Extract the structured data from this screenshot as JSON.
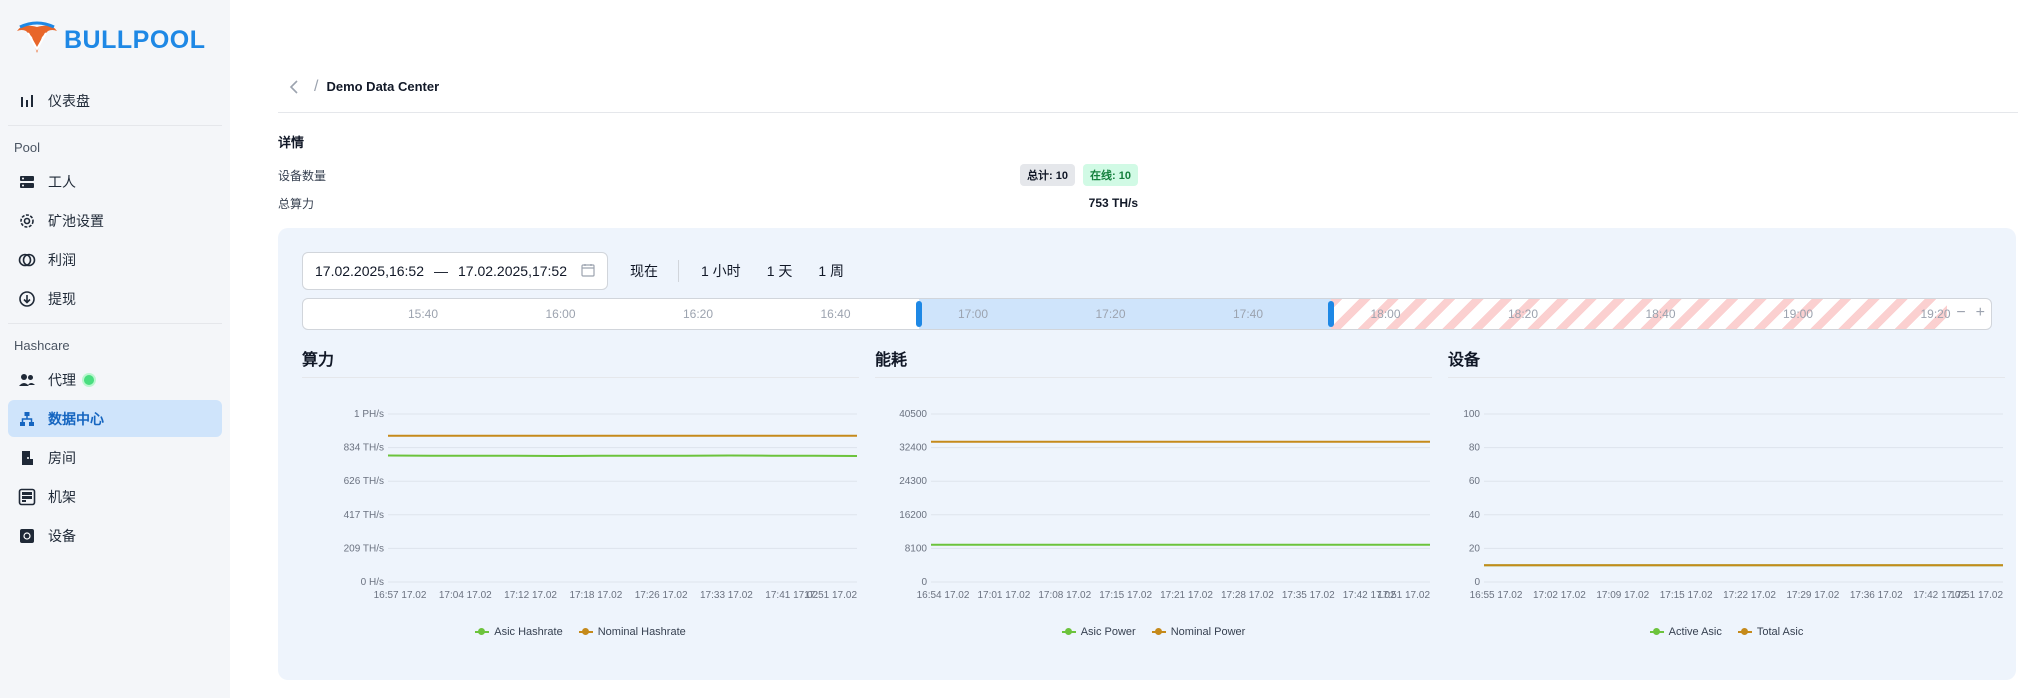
{
  "app": {
    "brand": "BULLPOOL"
  },
  "sidebar": {
    "dashboard": "仪表盘",
    "section_pool": "Pool",
    "pool_items": [
      {
        "label": "工人",
        "icon": "server-icon"
      },
      {
        "label": "矿池设置",
        "icon": "gear-icon"
      },
      {
        "label": "利润",
        "icon": "coins-icon"
      },
      {
        "label": "提现",
        "icon": "withdraw-icon"
      }
    ],
    "section_hashcare": "Hashcare",
    "hashcare_items": [
      {
        "label": "代理",
        "icon": "users-icon"
      },
      {
        "label": "数据中心",
        "icon": "sitemap-icon"
      },
      {
        "label": "房间",
        "icon": "door-icon"
      },
      {
        "label": "机架",
        "icon": "rack-icon"
      },
      {
        "label": "设备",
        "icon": "chip-icon"
      }
    ]
  },
  "breadcrumb": {
    "title": "Demo Data Center"
  },
  "details": {
    "title": "详情",
    "device_count_label": "设备数量",
    "total_badge": "总计: 10",
    "online_badge": "在线: 10",
    "hashrate_label": "总算力",
    "hashrate_value": "753 TH/s"
  },
  "controls": {
    "range_start": "17.02.2025,16:52",
    "range_sep": "—",
    "range_end": "17.02.2025,17:52",
    "now": "现在",
    "h1": "1 小时",
    "d1": "1 天",
    "w1": "1 周"
  },
  "timeline": {
    "labels": [
      "15:40",
      "16:00",
      "16:20",
      "16:40",
      "17:00",
      "17:20",
      "17:40",
      "18:00",
      "18:20",
      "18:40",
      "19:00",
      "19:20"
    ],
    "zoom_out": "−",
    "zoom_in": "+"
  },
  "colors": {
    "green": "#6cc33c",
    "orange": "#c58a1b",
    "accent": "#1e88e5"
  },
  "chart_data": [
    {
      "type": "line",
      "title": "算力",
      "ylim": [
        0,
        1000
      ],
      "y_tick_labels": [
        "0 H/s",
        "209 TH/s",
        "417 TH/s",
        "626 TH/s",
        "834 TH/s",
        "1 PH/s"
      ],
      "x_tick_labels": [
        "16:57 17.02",
        "17:04 17.02",
        "17:12 17.02",
        "17:18 17.02",
        "17:26 17.02",
        "17:33 17.02",
        "17:41 17.02",
        "17:51 17.02"
      ],
      "series": [
        {
          "name": "Asic Hashrate",
          "color": "#6cc33c",
          "values": [
            753,
            752,
            751,
            752,
            750,
            751,
            752,
            751,
            753,
            752,
            751,
            750
          ]
        },
        {
          "name": "Nominal Hashrate",
          "color": "#c58a1b",
          "values": [
            870,
            870,
            870,
            870,
            870,
            870,
            870,
            870,
            870,
            870,
            870,
            870
          ]
        }
      ]
    },
    {
      "type": "line",
      "title": "能耗",
      "ylim": [
        0,
        40500
      ],
      "y_tick_labels": [
        "0",
        "8100",
        "16200",
        "24300",
        "32400",
        "40500"
      ],
      "x_tick_labels": [
        "16:54 17.02",
        "17:01 17.02",
        "17:08 17.02",
        "17:15 17.02",
        "17:21 17.02",
        "17:28 17.02",
        "17:35 17.02",
        "17:42 17.02",
        "17:51 17.02"
      ],
      "series": [
        {
          "name": "Asic Power",
          "color": "#6cc33c",
          "values": [
            9000,
            9000,
            9000,
            9000,
            9000,
            9000,
            9000,
            9000,
            9000,
            9000,
            9000,
            9000
          ]
        },
        {
          "name": "Nominal Power",
          "color": "#c58a1b",
          "values": [
            33800,
            33800,
            33800,
            33800,
            33800,
            33800,
            33800,
            33800,
            33800,
            33800,
            33800,
            33800
          ]
        }
      ]
    },
    {
      "type": "line",
      "title": "设备",
      "ylim": [
        0,
        100
      ],
      "y_tick_labels": [
        "0",
        "20",
        "40",
        "60",
        "80",
        "100"
      ],
      "x_tick_labels": [
        "16:55 17.02",
        "17:02 17.02",
        "17:09 17.02",
        "17:15 17.02",
        "17:22 17.02",
        "17:29 17.02",
        "17:36 17.02",
        "17:42 17.02",
        "17:51 17.02"
      ],
      "series": [
        {
          "name": "Active Asic",
          "color": "#6cc33c",
          "values": [
            10,
            10,
            10,
            10,
            10,
            10,
            10,
            10,
            10,
            10,
            10,
            10
          ]
        },
        {
          "name": "Total Asic",
          "color": "#c58a1b",
          "values": [
            10,
            10,
            10,
            10,
            10,
            10,
            10,
            10,
            10,
            10,
            10,
            10
          ]
        }
      ]
    }
  ]
}
